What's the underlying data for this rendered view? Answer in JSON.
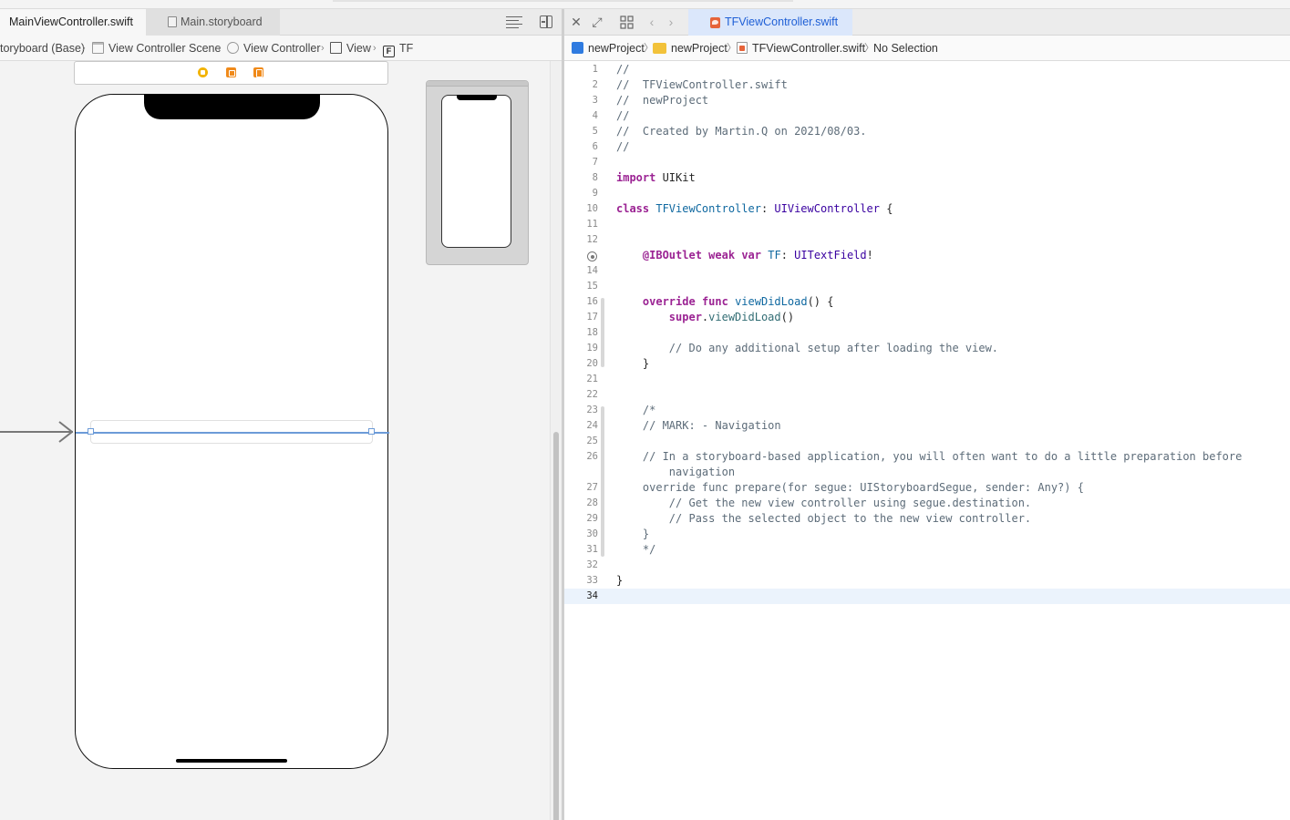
{
  "left_editor": {
    "tabs": [
      {
        "label": "MainViewController.swift",
        "active": true
      },
      {
        "label": "Main.storyboard",
        "active": false
      }
    ],
    "breadcrumb": [
      {
        "label": "toryboard (Base)"
      },
      {
        "label": "View Controller Scene",
        "icon": "scene-icon"
      },
      {
        "label": "View Controller",
        "icon": "view-controller-icon"
      },
      {
        "label": "View",
        "icon": "view-icon"
      },
      {
        "label": "TF",
        "icon": "textfield-icon",
        "icon_glyph": "F"
      }
    ],
    "separator": "›"
  },
  "right_editor": {
    "tab_label": "TFViewController.swift",
    "breadcrumb": [
      {
        "label": "newProject",
        "icon": "project-icon"
      },
      {
        "label": "newProject",
        "icon": "folder-icon"
      },
      {
        "label": "TFViewController.swift",
        "icon": "swift-file-icon"
      },
      {
        "label": "No Selection"
      }
    ],
    "separator": "〉",
    "current_line": 34,
    "code_lines": [
      {
        "n": "1",
        "tokens": [
          {
            "t": "//",
            "c": "com"
          }
        ]
      },
      {
        "n": "2",
        "tokens": [
          {
            "t": "//  TFViewController.swift",
            "c": "com"
          }
        ]
      },
      {
        "n": "3",
        "tokens": [
          {
            "t": "//  newProject",
            "c": "com"
          }
        ]
      },
      {
        "n": "4",
        "tokens": [
          {
            "t": "//",
            "c": "com"
          }
        ]
      },
      {
        "n": "5",
        "tokens": [
          {
            "t": "//  Created by Martin.Q on 2021/08/03.",
            "c": "com"
          }
        ]
      },
      {
        "n": "6",
        "tokens": [
          {
            "t": "//",
            "c": "com"
          }
        ]
      },
      {
        "n": "7",
        "tokens": []
      },
      {
        "n": "8",
        "tokens": [
          {
            "t": "import",
            "c": "kw"
          },
          {
            "t": " UIKit",
            "c": ""
          }
        ]
      },
      {
        "n": "9",
        "tokens": []
      },
      {
        "n": "10",
        "tokens": [
          {
            "t": "class",
            "c": "kw"
          },
          {
            "t": " ",
            "c": ""
          },
          {
            "t": "TFViewController",
            "c": "decl"
          },
          {
            "t": ": ",
            "c": ""
          },
          {
            "t": "UIViewController",
            "c": "type"
          },
          {
            "t": " {",
            "c": ""
          }
        ]
      },
      {
        "n": "11",
        "tokens": []
      },
      {
        "n": "12",
        "tokens": []
      },
      {
        "n": "",
        "tokens": [
          {
            "t": "    ",
            "c": ""
          },
          {
            "t": "@IBOutlet",
            "c": "kw"
          },
          {
            "t": " ",
            "c": ""
          },
          {
            "t": "weak",
            "c": "kw"
          },
          {
            "t": " ",
            "c": ""
          },
          {
            "t": "var",
            "c": "kw"
          },
          {
            "t": " ",
            "c": ""
          },
          {
            "t": "TF",
            "c": "decl"
          },
          {
            "t": ": ",
            "c": ""
          },
          {
            "t": "UITextField",
            "c": "type"
          },
          {
            "t": "!",
            "c": ""
          }
        ]
      },
      {
        "n": "14",
        "tokens": []
      },
      {
        "n": "15",
        "tokens": []
      },
      {
        "n": "16",
        "tokens": [
          {
            "t": "    ",
            "c": ""
          },
          {
            "t": "override",
            "c": "kw"
          },
          {
            "t": " ",
            "c": ""
          },
          {
            "t": "func",
            "c": "kw"
          },
          {
            "t": " ",
            "c": ""
          },
          {
            "t": "viewDidLoad",
            "c": "decl"
          },
          {
            "t": "() {",
            "c": ""
          }
        ]
      },
      {
        "n": "17",
        "tokens": [
          {
            "t": "        ",
            "c": ""
          },
          {
            "t": "super",
            "c": "kw"
          },
          {
            "t": ".",
            "c": ""
          },
          {
            "t": "viewDidLoad",
            "c": "func"
          },
          {
            "t": "()",
            "c": ""
          }
        ]
      },
      {
        "n": "18",
        "tokens": []
      },
      {
        "n": "19",
        "tokens": [
          {
            "t": "        // Do any additional setup after loading the view.",
            "c": "com"
          }
        ]
      },
      {
        "n": "20",
        "tokens": [
          {
            "t": "    }",
            "c": ""
          }
        ]
      },
      {
        "n": "21",
        "tokens": []
      },
      {
        "n": "22",
        "tokens": []
      },
      {
        "n": "23",
        "tokens": [
          {
            "t": "    /*",
            "c": "com"
          }
        ]
      },
      {
        "n": "24",
        "tokens": [
          {
            "t": "    // MARK: - Navigation",
            "c": "com"
          }
        ]
      },
      {
        "n": "25",
        "tokens": []
      },
      {
        "n": "26",
        "tokens": [
          {
            "t": "    // In a storyboard-based application, you will often want to do a little preparation before",
            "c": "com"
          }
        ]
      },
      {
        "n": "",
        "tokens": [
          {
            "t": "        navigation",
            "c": "com"
          }
        ]
      },
      {
        "n": "27",
        "tokens": [
          {
            "t": "    override func prepare(for segue: UIStoryboardSegue, sender: Any?) {",
            "c": "com"
          }
        ]
      },
      {
        "n": "28",
        "tokens": [
          {
            "t": "        // Get the new view controller using segue.destination.",
            "c": "com"
          }
        ]
      },
      {
        "n": "29",
        "tokens": [
          {
            "t": "        // Pass the selected object to the new view controller.",
            "c": "com"
          }
        ]
      },
      {
        "n": "30",
        "tokens": [
          {
            "t": "    }",
            "c": "com"
          }
        ]
      },
      {
        "n": "31",
        "tokens": [
          {
            "t": "    */",
            "c": "com"
          }
        ]
      },
      {
        "n": "32",
        "tokens": []
      },
      {
        "n": "33",
        "tokens": [
          {
            "t": "}",
            "c": ""
          }
        ]
      },
      {
        "n": "34",
        "tokens": []
      }
    ]
  },
  "colors": {
    "keyword": "#9b2393",
    "comment": "#5d6c79",
    "type": "#3900a0",
    "declaration": "#0f68a0",
    "active_tab": "#1e5fd6",
    "current_line_bg": "#ebf3fc",
    "constraint_blue": "#6c9bd8"
  }
}
